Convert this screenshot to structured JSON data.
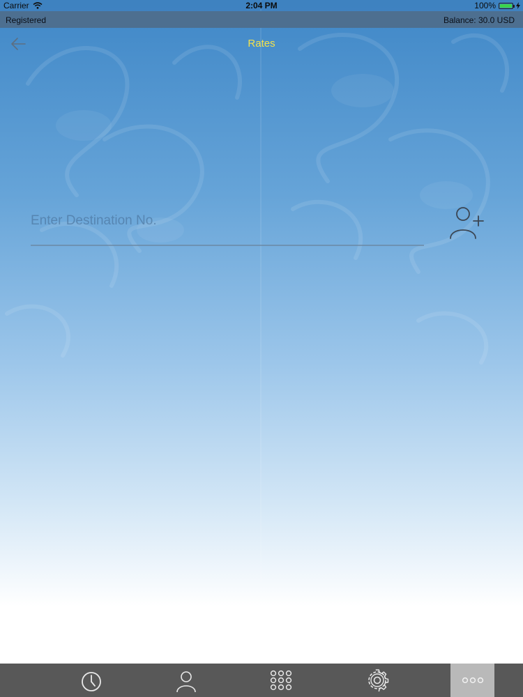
{
  "status_bar": {
    "carrier": "Carrier",
    "time": "2:04 PM",
    "battery_percent": "100%",
    "battery_level": 1.0,
    "battery_color": "#3cd34a"
  },
  "account_bar": {
    "status": "Registered",
    "balance": "Balance: 30.0 USD"
  },
  "nav": {
    "title": "Rates",
    "title_color": "#f4e24b",
    "back_icon": "back-arrow-icon"
  },
  "destination": {
    "placeholder": "Enter Destination No.",
    "value": "",
    "add_contact_icon": "add-contact-icon"
  },
  "tab_bar": {
    "tabs": [
      {
        "icon": "clock-icon",
        "active": false
      },
      {
        "icon": "person-icon",
        "active": false
      },
      {
        "icon": "keypad-icon",
        "active": false
      },
      {
        "icon": "gear-icon",
        "active": false
      },
      {
        "icon": "more-icon",
        "active": true
      }
    ]
  }
}
